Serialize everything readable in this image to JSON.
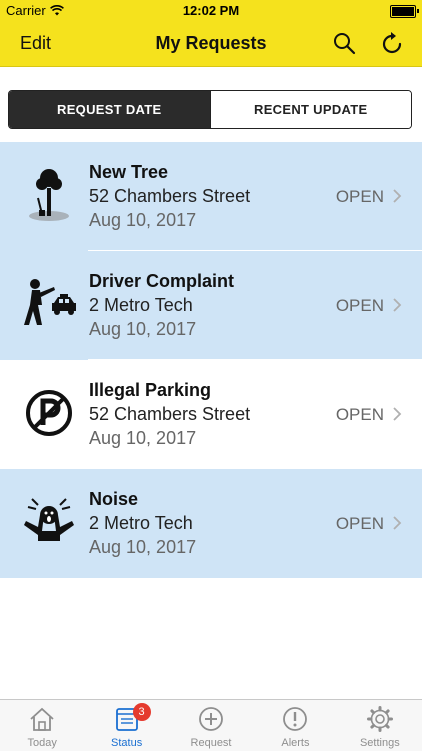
{
  "status_bar": {
    "carrier": "Carrier",
    "time": "12:02 PM"
  },
  "nav": {
    "edit_label": "Edit",
    "title": "My Requests",
    "search_icon": "search-icon",
    "refresh_icon": "refresh-icon"
  },
  "segments": {
    "request_date": "REQUEST DATE",
    "recent_update": "RECENT UPDATE",
    "active": "request_date"
  },
  "requests": [
    {
      "title": "New Tree",
      "address": "52 Chambers Street",
      "date": "Aug 10, 2017",
      "status": "OPEN",
      "icon": "tree-icon",
      "highlight": true
    },
    {
      "title": "Driver Complaint",
      "address": "2 Metro Tech",
      "date": "Aug 10, 2017",
      "status": "OPEN",
      "icon": "driver-complaint-icon",
      "highlight": true
    },
    {
      "title": "Illegal Parking",
      "address": "52 Chambers Street",
      "date": "Aug 10, 2017",
      "status": "OPEN",
      "icon": "parking-icon",
      "highlight": false
    },
    {
      "title": "Noise",
      "address": "2 Metro Tech",
      "date": "Aug 10, 2017",
      "status": "OPEN",
      "icon": "noise-icon",
      "highlight": true
    }
  ],
  "tabs": [
    {
      "label": "Today",
      "icon": "home-icon"
    },
    {
      "label": "Status",
      "icon": "status-icon",
      "badge": "3",
      "active": true
    },
    {
      "label": "Request",
      "icon": "add-circle-icon"
    },
    {
      "label": "Alerts",
      "icon": "alert-icon"
    },
    {
      "label": "Settings",
      "icon": "gear-icon"
    }
  ],
  "colors": {
    "accent_yellow": "#f5e21d",
    "row_highlight": "#cfe4f6",
    "tab_active": "#1a6fd1",
    "badge": "#e53a2e"
  }
}
